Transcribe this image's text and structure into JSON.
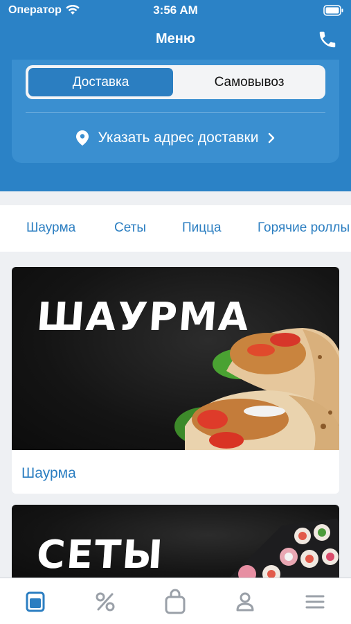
{
  "status_bar": {
    "carrier": "Оператор",
    "time": "3:56 AM"
  },
  "nav": {
    "title": "Меню"
  },
  "delivery": {
    "mode_delivery": "Доставка",
    "mode_pickup": "Самовывоз",
    "selected_mode": "Доставка",
    "address_prompt": "Указать адрес доставки"
  },
  "categories": [
    "Шаурма",
    "Сеты",
    "Пицца",
    "Горячие роллы"
  ],
  "products": [
    {
      "banner": "ШАУРМА",
      "caption": "Шаурма"
    },
    {
      "banner": "СЕТЫ",
      "caption": ""
    }
  ],
  "tab_bar": {
    "items": [
      "menu-icon",
      "percent-icon",
      "bag-icon",
      "profile-icon",
      "hamburger-icon"
    ],
    "active": "menu-icon"
  },
  "colors": {
    "primary": "#2b82c6",
    "accent_text": "#2b7ec1",
    "inactive_icon": "#9aa0a8"
  }
}
